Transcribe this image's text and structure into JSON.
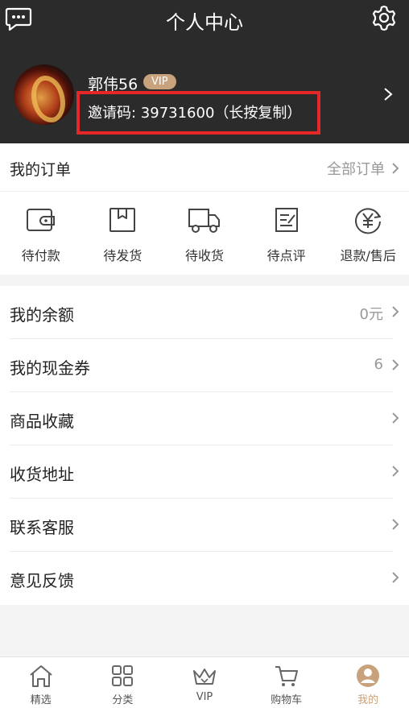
{
  "header": {
    "title": "个人中心"
  },
  "profile": {
    "username": "郭伟56",
    "vip_badge": "VIP",
    "invite_text": "邀请码: 39731600（长按复制）"
  },
  "orders": {
    "title": "我的订单",
    "all_link": "全部订单",
    "items": [
      {
        "label": "待付款",
        "icon": "wallet-icon"
      },
      {
        "label": "待发货",
        "icon": "package-icon"
      },
      {
        "label": "待收货",
        "icon": "truck-icon"
      },
      {
        "label": "待点评",
        "icon": "review-icon"
      },
      {
        "label": "退款/售后",
        "icon": "refund-yen-icon"
      }
    ]
  },
  "menu": [
    {
      "label": "我的余额",
      "value": "0元"
    },
    {
      "label": "我的现金券",
      "value": "6"
    },
    {
      "label": "商品收藏",
      "value": ""
    },
    {
      "label": "收货地址",
      "value": ""
    },
    {
      "label": "联系客服",
      "value": ""
    },
    {
      "label": "意见反馈",
      "value": ""
    }
  ],
  "bottom_nav": {
    "items": [
      {
        "label": "精选",
        "icon": "home-icon"
      },
      {
        "label": "分类",
        "icon": "grid-icon"
      },
      {
        "label": "VIP",
        "icon": "crown-icon"
      },
      {
        "label": "购物车",
        "icon": "cart-icon"
      },
      {
        "label": "我的",
        "icon": "user-icon"
      }
    ],
    "active_index": 4
  },
  "colors": {
    "header_bg": "#2b2b2b",
    "accent_gold": "#c8a27c",
    "highlight_red": "#e52727"
  }
}
